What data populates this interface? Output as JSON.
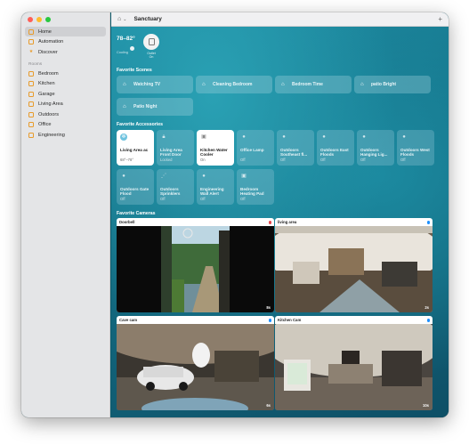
{
  "sidebar": {
    "items": [
      {
        "label": "Home",
        "icon": "house-icon"
      },
      {
        "label": "Automation",
        "icon": "automation-icon"
      },
      {
        "label": "Discover",
        "icon": "star-icon"
      }
    ],
    "rooms_heading": "Rooms",
    "rooms": [
      "Bedroom",
      "Kitchen",
      "Garage",
      "Living Area",
      "Outdoors",
      "Office",
      "Engineering"
    ]
  },
  "toolbar": {
    "home_name": "Sanctuary",
    "add_icon": "plus-icon"
  },
  "status": {
    "temperature": "78–82°",
    "cooling_label": "Cooling",
    "outlet_label": "Outlet",
    "outlet_state": "On"
  },
  "favorite_scenes": {
    "heading": "Favorite Scenes",
    "items": [
      "Watching TV",
      "Cleaning Bedroom",
      "Bedroom Time",
      "patio Bright",
      "Patio Night"
    ]
  },
  "favorite_accessories": {
    "heading": "Favorite Accessories",
    "items": [
      {
        "name": "Living Area ac",
        "state": "68°–78°",
        "on": true
      },
      {
        "name": "Living Area Front Door",
        "state": "Locked",
        "on": false
      },
      {
        "name": "Kitchen Water Cooler",
        "state": "On",
        "on": true
      },
      {
        "name": "Office Lamp",
        "state": "Off",
        "on": false
      },
      {
        "name": "Outdoors Southeast fl...",
        "state": "Off",
        "on": false
      },
      {
        "name": "Outdoors East Floods",
        "state": "Off",
        "on": false
      },
      {
        "name": "Outdoors Hanging Lig...",
        "state": "Off",
        "on": false
      },
      {
        "name": "Outdoors West Floods",
        "state": "Off",
        "on": false
      },
      {
        "name": "Outdoors Gate Flood",
        "state": "Off",
        "on": false
      },
      {
        "name": "Outdoors Sprinklers",
        "state": "Off",
        "on": false
      },
      {
        "name": "Engineering Wall Alert",
        "state": "Off",
        "on": false
      },
      {
        "name": "Bedroom Heating Pad",
        "state": "Off",
        "on": false
      }
    ]
  },
  "favorite_cameras": {
    "heading": "Favorite Cameras",
    "items": [
      {
        "name": "Doorbell",
        "time": "8s",
        "dot_color": "#e5484d"
      },
      {
        "name": "living area",
        "time": "2s",
        "dot_color": "#1e90ff"
      },
      {
        "name": "Cave cam",
        "time": "6s",
        "dot_color": "#1e90ff"
      },
      {
        "name": "Kitchen Cam",
        "time": "10s",
        "dot_color": "#1e90ff"
      }
    ]
  },
  "colors": {
    "accent": "#e89b2a",
    "main_bg": "#1f8fa6"
  }
}
